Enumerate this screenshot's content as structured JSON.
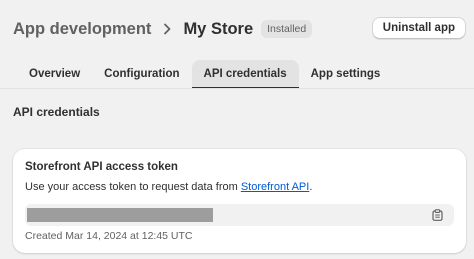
{
  "header": {
    "breadcrumb_parent": "App development",
    "title": "My Store",
    "status_badge": "Installed",
    "uninstall_label": "Uninstall app"
  },
  "tabs": [
    {
      "label": "Overview",
      "active": false
    },
    {
      "label": "Configuration",
      "active": false
    },
    {
      "label": "API credentials",
      "active": true
    },
    {
      "label": "App settings",
      "active": false
    }
  ],
  "section": {
    "title": "API credentials"
  },
  "token_card": {
    "title": "Storefront API access token",
    "description_prefix": "Use your access token to request data from ",
    "description_link": "Storefront API",
    "description_suffix": ".",
    "created_text": "Created Mar 14, 2024 at 12:45 UTC",
    "copy_icon": "clipboard-icon"
  },
  "colors": {
    "background": "#f1f1f1",
    "link": "#005bd3",
    "active_tab_bg": "#e3e3e3",
    "token_mask": "#9d9d9d"
  }
}
